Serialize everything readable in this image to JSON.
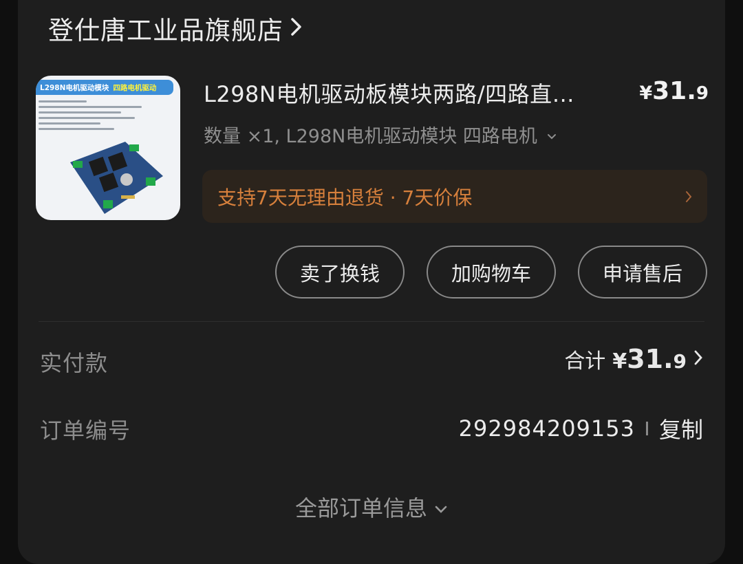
{
  "shop": {
    "name": "登仕唐工业品旗舰店"
  },
  "product": {
    "title": "L298N电机驱动板模块两路/四路直…",
    "price_symbol": "¥",
    "price_int": "31.",
    "price_dec": "9",
    "spec": "数量 ×1, L298N电机驱动模块 四路电机",
    "thumbnail": {
      "banner": "L298N电机驱动模块",
      "tag": "四路电机驱动"
    }
  },
  "service": {
    "text": "支持7天无理由退货 · 7天价保"
  },
  "actions": [
    "卖了换钱",
    "加购物车",
    "申请售后"
  ],
  "payment": {
    "label": "实付款",
    "total_label": "合计",
    "symbol": "¥",
    "amount_int": "31.",
    "amount_dec": "9"
  },
  "order": {
    "label": "订单编号",
    "number": "292984209153",
    "copy": "复制"
  },
  "footer": {
    "all_info": "全部订单信息"
  },
  "colors": {
    "background": "#1e1e1e",
    "service_bg": "#2c241c",
    "service_text": "#d7803c"
  },
  "icons": {
    "shop_chevron": "chevron-right-icon",
    "spec_chevron": "chevron-down-icon",
    "service_chevron": "chevron-right-icon",
    "total_chevron": "chevron-right-icon",
    "footer_chevron": "chevron-down-icon"
  }
}
